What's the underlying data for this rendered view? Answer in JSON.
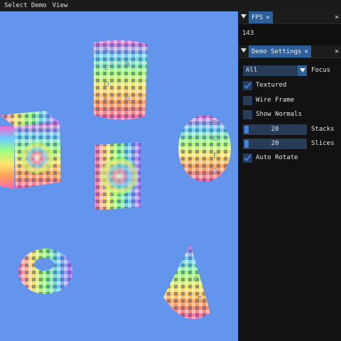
{
  "menubar": {
    "items": [
      "Select Demo",
      "View"
    ]
  },
  "fps_window": {
    "tab_label": "FPS",
    "fps": "143"
  },
  "settings_window": {
    "tab_label": "Demo Settings",
    "demo_select": {
      "value": "All",
      "label": "Focus"
    },
    "textured": {
      "label": "Textured",
      "checked": true
    },
    "wireframe": {
      "label": "Wire Frame",
      "checked": false
    },
    "show_normals": {
      "label": "Show Normals",
      "checked": false
    },
    "stacks": {
      "label": "Stacks",
      "value": "20"
    },
    "slices": {
      "label": "Slices",
      "value": "20"
    },
    "auto_rotate": {
      "label": "Auto Rotate",
      "checked": true
    }
  },
  "texture_letters": [
    "A",
    "B",
    "C",
    "D",
    "E",
    "F",
    "G",
    "H"
  ],
  "colors": {
    "viewport_bg": "#6495ed",
    "accent": "#2d5f9a",
    "frame_bg": "#263c58"
  },
  "icons": {
    "dropdown": "triangle-down-icon",
    "close": "close-icon",
    "check": "checkmark-icon"
  }
}
